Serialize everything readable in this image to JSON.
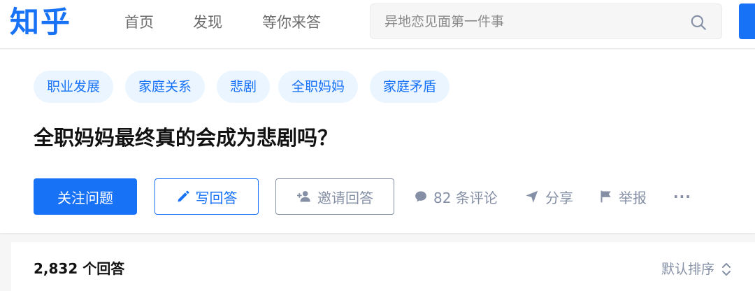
{
  "header": {
    "logo": "知乎",
    "nav": [
      "首页",
      "发现",
      "等你来答"
    ],
    "search_placeholder": "异地恋见面第一件事"
  },
  "question": {
    "topics": [
      "职业发展",
      "家庭关系",
      "悲剧",
      "全职妈妈",
      "家庭矛盾"
    ],
    "title": "全职妈妈最终真的会成为悲剧吗？",
    "follow_label": "关注问题",
    "write_label": "写回答",
    "invite_label": "邀请回答",
    "comments_label": "82 条评论",
    "share_label": "分享",
    "report_label": "举报",
    "more_label": "···"
  },
  "answers": {
    "count_label": "2,832 个回答",
    "sort_label": "默认排序"
  },
  "colors": {
    "brand": "#1772f6",
    "topic_bg": "#ebf5ff",
    "muted": "#8590a6"
  }
}
